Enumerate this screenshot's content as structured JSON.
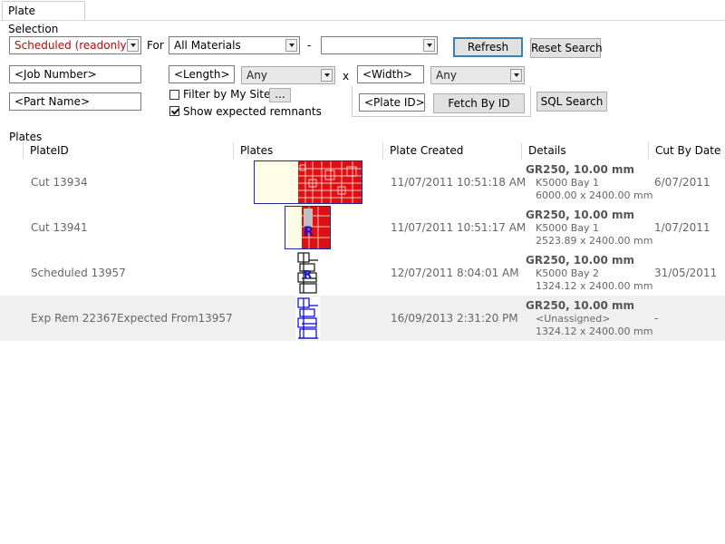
{
  "tab": {
    "label": "Plate Selection"
  },
  "filters": {
    "status_value": "Scheduled (readonly)",
    "status_color": "#cc0000",
    "for_label": "For",
    "material_value": "All Materials",
    "dash_label": "-",
    "material2_value": "",
    "refresh_label": "Refresh",
    "reset_label": "Reset Search",
    "job_number": "<Job Number>",
    "length_value": "<Length>",
    "length_mode": "Any",
    "x_label": "x",
    "width_value": "<Width>",
    "width_mode": "Any",
    "part_name": "<Part Name>",
    "filter_my_sites_label": "Filter by My Sites",
    "filter_my_sites_checked": false,
    "ellipsis_label": "...",
    "show_remnants_label": "Show expected remnants",
    "show_remnants_checked": true,
    "plate_id": "<Plate ID>",
    "fetch_by_id_label": "Fetch By ID",
    "sql_search_label": "SQL Search"
  },
  "grid": {
    "title": "Plates",
    "columns": [
      "PlateID",
      "Plates",
      "Plate Created",
      "Details",
      "Cut By Date"
    ],
    "rows": [
      {
        "id": "Cut 13934",
        "created": "11/07/2011 10:51:18 AM",
        "grade": "GR250, 10.00 mm",
        "location": "K5000 Bay 1",
        "size": "6000.00 x 2400.00 mm",
        "cut_by": "6/07/2011",
        "thumb_color": "#cc0000"
      },
      {
        "id": "Cut 13941",
        "created": "11/07/2011 10:51:17 AM",
        "grade": "GR250, 10.00 mm",
        "location": "K5000 Bay 1",
        "size": "2523.89 x 2400.00 mm",
        "cut_by": "1/07/2011",
        "thumb_color": "#cc0000",
        "thumb_mark": "R"
      },
      {
        "id": "Scheduled 13957",
        "created": "12/07/2011 8:04:01 AM",
        "grade": "GR250, 10.00 mm",
        "location": "K5000 Bay 2",
        "size": "1324.12 x 2400.00 mm",
        "cut_by": "31/05/2011",
        "thumb_color": "#111111",
        "thumb_mark": "R"
      },
      {
        "id": "Exp Rem 22367Expected From13957",
        "created": "16/09/2013 2:31:20 PM",
        "grade": "GR250, 10.00 mm",
        "location": "<Unassigned>",
        "size": "1324.12 x 2400.00 mm",
        "cut_by": "-",
        "thumb_color": "#0000dd"
      }
    ]
  }
}
